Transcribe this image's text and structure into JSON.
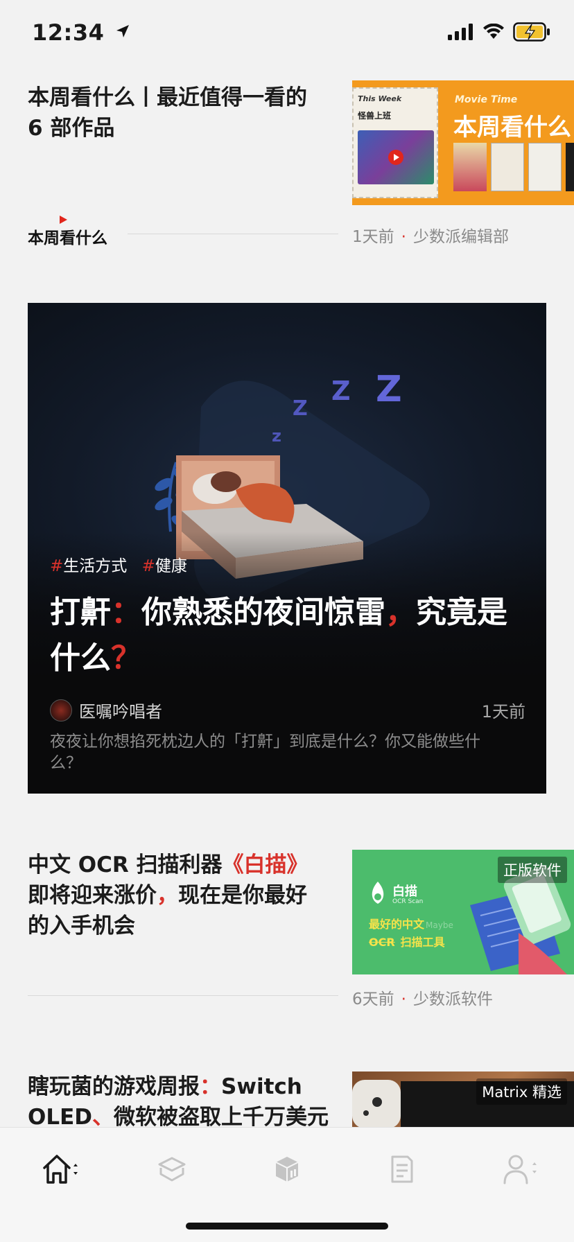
{
  "status_bar": {
    "time": "12:34",
    "battery_state": "charging",
    "accent": "#f2c230"
  },
  "articles": [
    {
      "title": "本周看什么丨最近值得一看的 6 部作品",
      "column_logo": "本周看什么",
      "age": "1天前",
      "source": "少数派编辑部",
      "thumb": {
        "label_small": "This Week",
        "label_cn": "怪兽上班",
        "banner_en": "Movie Time",
        "banner_cn": "本周看什么"
      }
    },
    {
      "title_parts": [
        "中文 OCR 扫描利器",
        "《白描》",
        "即将迎来涨价",
        "，",
        "现在是你最好的入手机会"
      ],
      "age": "6天前",
      "source": "少数派软件",
      "badge": "正版软件",
      "thumb": {
        "app_name": "白描",
        "app_sub": "OCR Scan",
        "line1": "最好的中文",
        "line1_strike": "Maybe",
        "line2_strike": "OCR",
        "line2": "扫描工具"
      }
    },
    {
      "title_parts": [
        "瞎玩菌的游戏周报",
        "：",
        "Switch OLED",
        "、",
        "微软被盗取上千万美元"
      ],
      "badge": "Matrix 精选"
    }
  ],
  "feature": {
    "tags": [
      "生活方式",
      "健康"
    ],
    "title_parts": [
      "打鼾",
      "：",
      "你熟悉的夜间惊雷",
      "，",
      "究竟是什么",
      "？"
    ],
    "author": "医嘱吟唱者",
    "age": "1天前",
    "description": "夜夜让你想掐死枕边人的「打鼾」到底是什么？你又能做些什么？"
  },
  "tabbar": {
    "tabs": [
      {
        "name": "home",
        "icon": "house-icon",
        "active": true
      },
      {
        "name": "matrix",
        "icon": "layers-icon",
        "active": false
      },
      {
        "name": "store",
        "icon": "box-icon",
        "active": false
      },
      {
        "name": "notes",
        "icon": "document-icon",
        "active": false
      },
      {
        "name": "profile",
        "icon": "person-icon",
        "active": false
      }
    ]
  },
  "colors": {
    "accent_red": "#d8322b",
    "background": "#f2f2f2",
    "card_bg": "#0a0a0b"
  }
}
